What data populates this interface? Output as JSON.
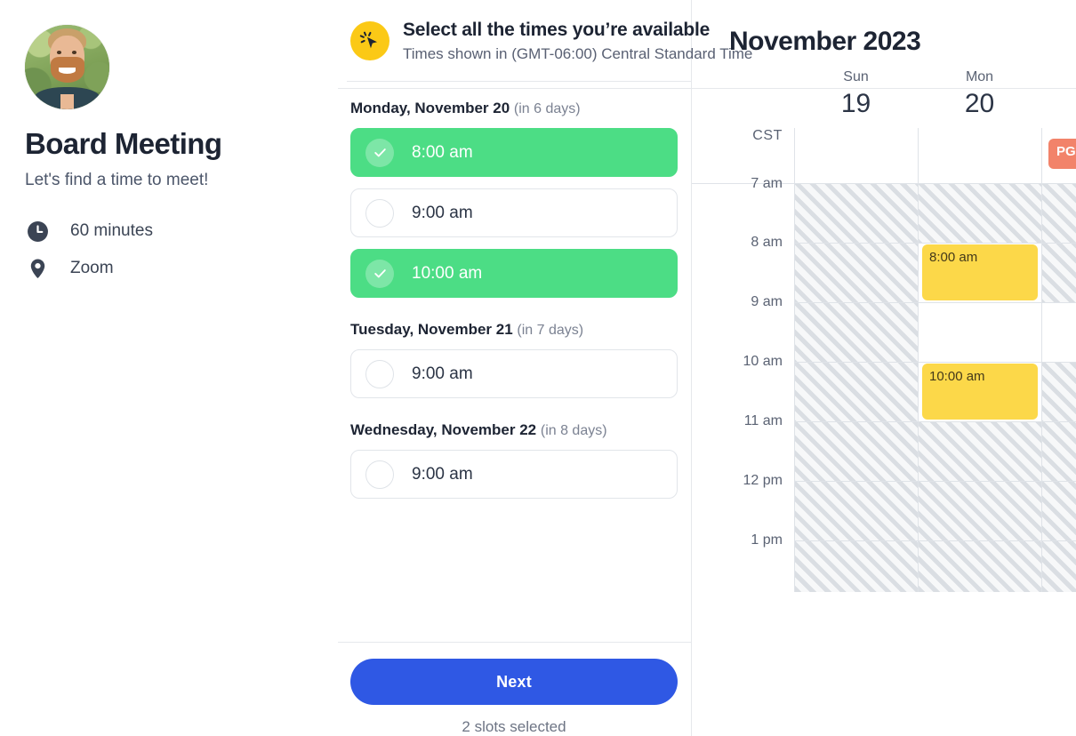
{
  "meeting": {
    "avatar_alt": "host-avatar-photo",
    "title": "Board Meeting",
    "subtitle": "Let's find a time to meet!",
    "details": [
      {
        "icon": "clock-icon",
        "label": "60 minutes"
      },
      {
        "icon": "location-pin-icon",
        "label": "Zoom"
      }
    ]
  },
  "selector": {
    "icon": "cursor-click-icon",
    "heading": "Select all the times you’re available",
    "timezone_note": "Times shown in (GMT-06:00) Central Standard Time",
    "days": [
      {
        "heading": "Monday, November 20",
        "relative": "(in 6 days)",
        "slots": [
          {
            "time": "8:00 am",
            "selected": true
          },
          {
            "time": "9:00 am",
            "selected": false
          },
          {
            "time": "10:00 am",
            "selected": true
          }
        ]
      },
      {
        "heading": "Tuesday, November 21",
        "relative": "(in 7 days)",
        "slots": [
          {
            "time": "9:00 am",
            "selected": false
          }
        ]
      },
      {
        "heading": "Wednesday, November 22",
        "relative": "(in 8 days)",
        "slots": [
          {
            "time": "9:00 am",
            "selected": false
          }
        ]
      }
    ],
    "next_label": "Next",
    "slots_selected_label": "2 slots selected"
  },
  "calendar": {
    "month_title": "November 2023",
    "timezone_abbr": "CST",
    "days": [
      {
        "dow": "Sun",
        "dom": "19"
      },
      {
        "dow": "Mon",
        "dom": "20"
      },
      {
        "dow": "",
        "dom": ""
      }
    ],
    "time_labels": [
      "7 am",
      "8 am",
      "9 am",
      "10 am",
      "11 am",
      "12 pm",
      "1 pm"
    ],
    "events": [
      {
        "day": "Mon",
        "label": "8:00 am",
        "start": "8 am",
        "end": "9 am"
      },
      {
        "day": "Mon",
        "label": "10:00 am",
        "start": "10 am",
        "end": "11 am"
      }
    ],
    "all_day_badge": {
      "label": "PG",
      "color": "#f2836a"
    }
  },
  "colors": {
    "selected_slot": "#4cdd85",
    "primary_button": "#2f58e4",
    "accent_badge": "#fbc916",
    "event_yellow": "#fcd849",
    "text_dark": "#1d2433",
    "text_muted": "#6d7484"
  }
}
